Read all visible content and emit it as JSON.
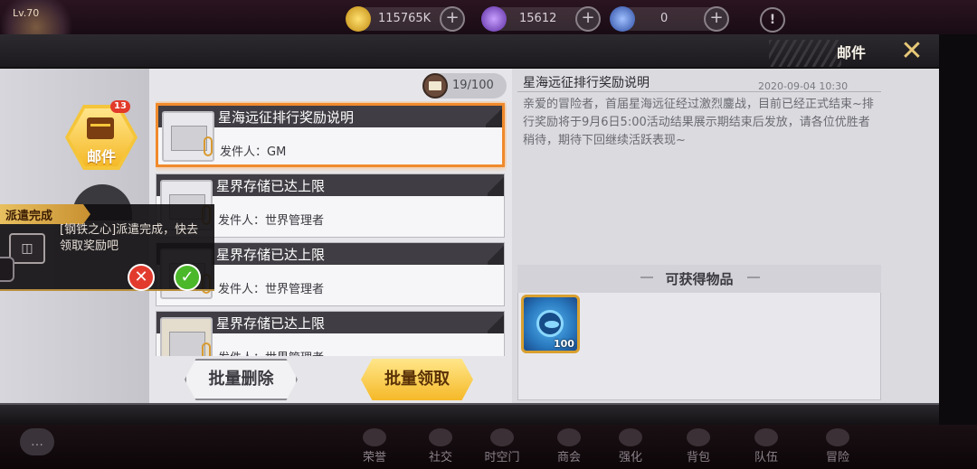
{
  "top": {
    "level": "Lv.70",
    "resources": [
      {
        "icon": "gold-coin-icon",
        "value": "115765K"
      },
      {
        "icon": "diamond-icon",
        "value": "15612"
      },
      {
        "icon": "star-token-icon",
        "value": "0"
      }
    ],
    "plus": "+",
    "alert": "!"
  },
  "panel": {
    "title": "邮件",
    "close": "✕",
    "counter": "19/100"
  },
  "tabs": {
    "mail_label": "邮件",
    "badge": "13"
  },
  "notice": {
    "tag": "派遣完成",
    "text": "[钢铁之心]派遣完成，快去领取奖励吧",
    "reject": "✕",
    "accept": "✓"
  },
  "mails": [
    {
      "title": "星海远征排行奖励说明",
      "sender": "发件人：GM",
      "selected": true
    },
    {
      "title": "星界存储已达上限",
      "sender": "发件人：世界管理者",
      "selected": false
    },
    {
      "title": "星界存储已达上限",
      "sender": "发件人：世界管理者",
      "selected": false
    },
    {
      "title": "星界存储已达上限",
      "sender": "发件人：世界管理者",
      "selected": false
    }
  ],
  "actions": {
    "delete_all": "批量删除",
    "claim_all": "批量领取",
    "claim": "领取"
  },
  "detail": {
    "title": "星海远征排行奖励说明",
    "date": "2020-09-04 10:30",
    "body": "亲爱的冒险者，首届星海远征经过激烈鏖战，目前已经正式结束~排行奖励将于9月6日5:00活动结果展示期结束后发放，请各位优胜者稍待，期待下回继续活跃表现~",
    "items_header": "可获得物品",
    "reward_qty": "100"
  },
  "bottom_nav": [
    "荣誉",
    "社交",
    "时空门",
    "商会",
    "强化",
    "背包",
    "队伍",
    "冒险"
  ],
  "colors": {
    "accent": "#f5b928",
    "selected_border": "#f08a2c"
  }
}
